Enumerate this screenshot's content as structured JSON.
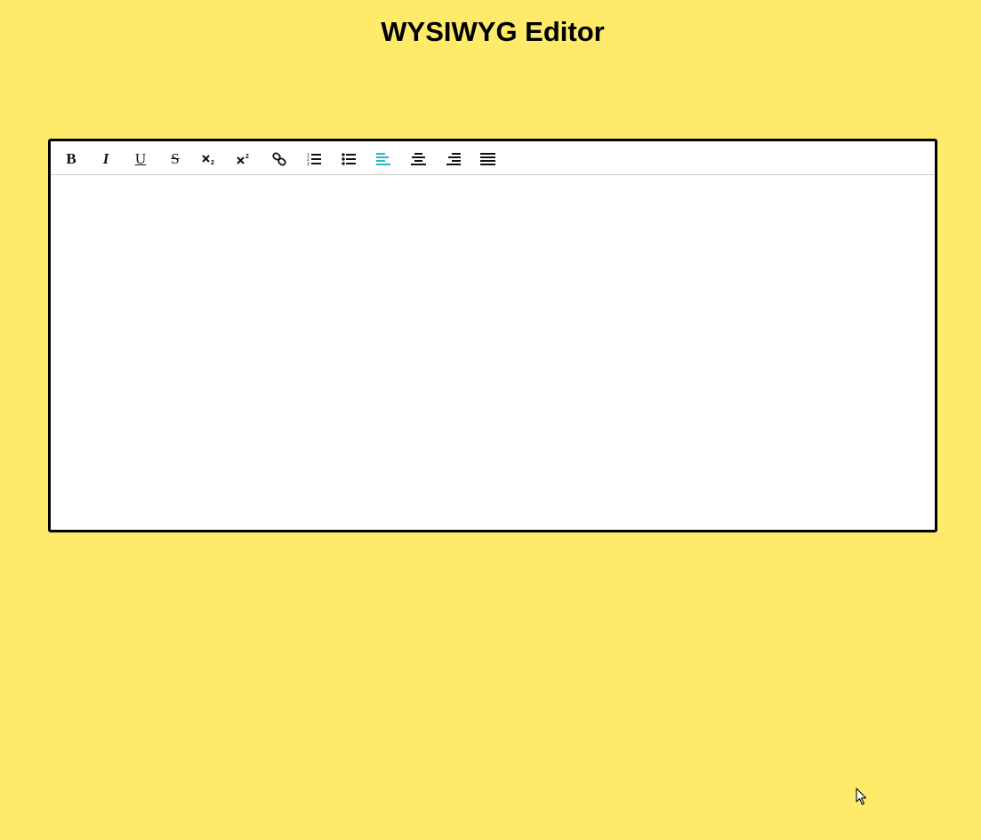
{
  "page": {
    "title": "WYSIWYG Editor",
    "background": "#ffeb69"
  },
  "toolbar": {
    "active_color": "#29b6c5",
    "buttons": [
      {
        "name": "bold",
        "glyph": "B",
        "icon": "bold-icon",
        "active": false
      },
      {
        "name": "italic",
        "glyph": "I",
        "icon": "italic-icon",
        "active": false
      },
      {
        "name": "underline",
        "glyph": "U",
        "icon": "underline-icon",
        "active": false
      },
      {
        "name": "strikethrough",
        "glyph": "S",
        "icon": "strikethrough-icon",
        "active": false
      },
      {
        "name": "subscript",
        "icon": "subscript-icon",
        "active": false
      },
      {
        "name": "superscript",
        "icon": "superscript-icon",
        "active": false
      },
      {
        "name": "link",
        "icon": "link-icon",
        "active": false
      },
      {
        "name": "ordered-list",
        "icon": "ordered-list-icon",
        "active": false
      },
      {
        "name": "unordered-list",
        "icon": "unordered-list-icon",
        "active": false
      },
      {
        "name": "align-left",
        "icon": "align-left-icon",
        "active": true
      },
      {
        "name": "align-center",
        "icon": "align-center-icon",
        "active": false
      },
      {
        "name": "align-right",
        "icon": "align-right-icon",
        "active": false
      },
      {
        "name": "align-justify",
        "icon": "align-justify-icon",
        "active": false
      }
    ]
  },
  "editor": {
    "content": ""
  }
}
